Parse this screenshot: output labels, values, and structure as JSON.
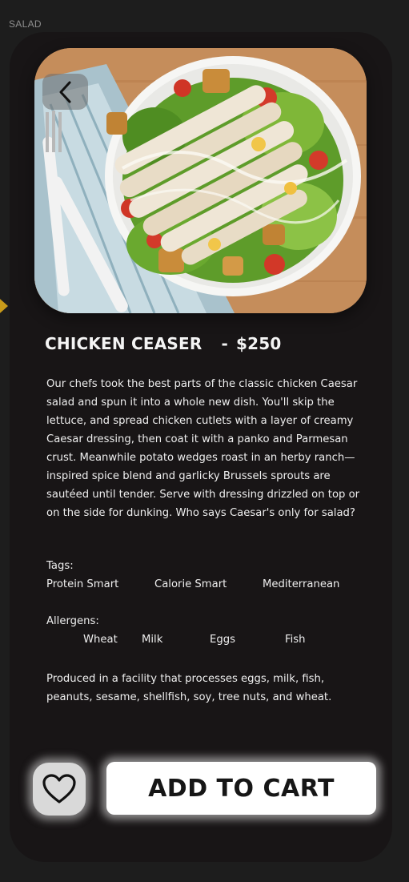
{
  "section": {
    "label": "SALAD"
  },
  "icons": {
    "back": "chevron-left-icon",
    "favorite": "heart-outline-icon"
  },
  "product": {
    "name": "CHICKEN CEASER",
    "separator": "-",
    "price": "$250",
    "description": "Our chefs took the best parts of the classic chicken Caesar salad and spun it into a whole new dish. You'll skip the lettuce, and spread chicken cutlets with a layer of creamy Caesar dressing, then coat it with a panko and Parmesan crust. Meanwhile potato wedges roast in an herby ranch—inspired spice blend and garlicky Brussels sprouts are sautéed until tender. Serve with dressing drizzled on top or on the side for dunking. Who says Caesar's only for salad?",
    "tags_label": "Tags:",
    "tags": [
      "Protein Smart",
      "Calorie Smart",
      "Mediterranean"
    ],
    "allergens_label": "Allergens:",
    "allergens": [
      "Wheat",
      "Milk",
      "Eggs",
      "Fish"
    ],
    "facility_note": "Produced in a facility that processes eggs, milk, fish, peanuts, sesame, shellfish, soy, tree nuts, and wheat."
  },
  "actions": {
    "add_to_cart": "ADD TO CART"
  },
  "colors": {
    "background": "#1d1d1d",
    "card": "#181516",
    "accent": "#c99b1a",
    "button": "#ffffff"
  }
}
